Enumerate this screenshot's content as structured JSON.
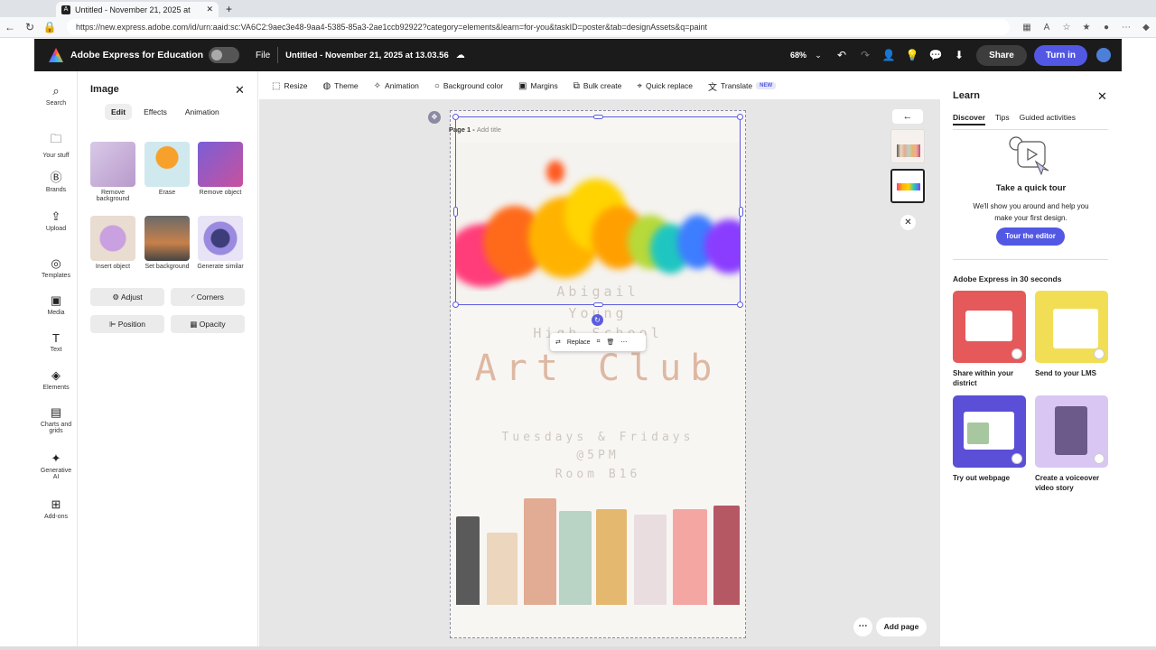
{
  "browser": {
    "tab_title": "Untitled - November 21, 2025 at",
    "url": "https://new.express.adobe.com/id/urn:aaid:sc:VA6C2:9aec3e48-9aa4-5385-85a3-2ae1ccb92922?category=elements&learn=for-you&taskID=poster&tab=designAssets&q=paint"
  },
  "appbar": {
    "app_name": "Adobe Express for Education",
    "file_label": "File",
    "doc_title": "Untitled - November 21, 2025 at 13.03.56",
    "zoom": "68%",
    "share_label": "Share",
    "turnin_label": "Turn in"
  },
  "rail": [
    {
      "label": "Search",
      "icon": "search-icon"
    },
    {
      "label": "Your stuff",
      "icon": "folder-icon"
    },
    {
      "label": "Brands",
      "icon": "brand-icon"
    },
    {
      "label": "Upload",
      "icon": "upload-icon"
    },
    {
      "label": "Templates",
      "icon": "templates-icon"
    },
    {
      "label": "Media",
      "icon": "media-icon"
    },
    {
      "label": "Text",
      "icon": "text-icon"
    },
    {
      "label": "Elements",
      "icon": "elements-icon"
    },
    {
      "label": "Charts and grids",
      "icon": "charts-icon"
    },
    {
      "label": "Generative AI",
      "icon": "generative-ai-icon"
    },
    {
      "label": "Add-ons",
      "icon": "addons-icon"
    }
  ],
  "image_panel": {
    "title": "Image",
    "tabs": [
      "Edit",
      "Effects",
      "Animation"
    ],
    "tools": [
      "Remove background",
      "Erase",
      "Remove object",
      "Insert object",
      "Set background",
      "Generate similar"
    ],
    "buttons": [
      "Adjust",
      "Corners",
      "Position",
      "Opacity"
    ]
  },
  "toolbar": {
    "items": [
      "Resize",
      "Theme",
      "Animation",
      "Background color",
      "Margins",
      "Bulk create",
      "Quick replace",
      "Translate"
    ],
    "new_badge": "NEW"
  },
  "canvas": {
    "page_label": "Page 1 -",
    "add_title": "Add title",
    "poster": {
      "name_line1": "Abigail",
      "name_line2": "Young",
      "name_line3": "High School",
      "headline": "Art Club",
      "line1": "Tuesdays & Fridays",
      "line2": "@5PM",
      "line3": "Room B16"
    },
    "replace_label": "Replace",
    "add_page_label": "Add page"
  },
  "learn": {
    "title": "Learn",
    "tabs": [
      "Discover",
      "Tips",
      "Guided activities"
    ],
    "tour_title": "Take a quick tour",
    "tour_sub": "We'll show you around and help you make your first design.",
    "tour_button": "Tour the editor",
    "section": "Adobe Express in 30 seconds",
    "cards": [
      {
        "label": "Share within your district",
        "color": "#e5595a"
      },
      {
        "label": "Send to your LMS",
        "color": "#f2de55"
      },
      {
        "label": "Try out webpage",
        "color": "#5a4fd6"
      },
      {
        "label": "Create a voiceover video story",
        "color": "#d9c6f2"
      }
    ]
  },
  "colors": {
    "accent": "#5258e4",
    "appbar": "#1b1b1b"
  }
}
